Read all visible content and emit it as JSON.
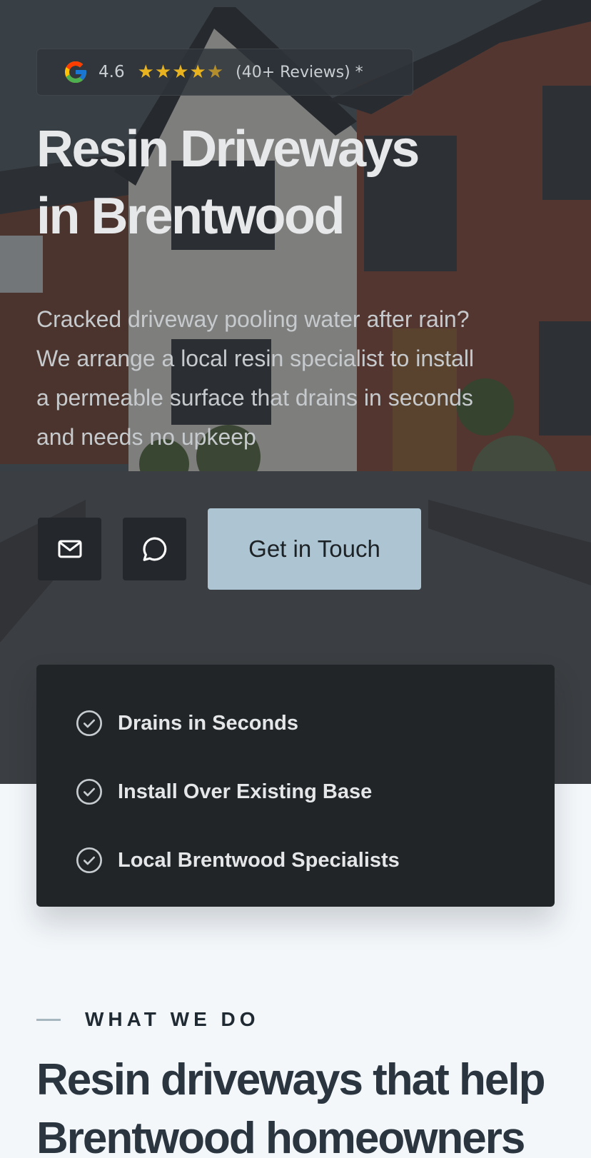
{
  "rating": {
    "icon": "google-icon",
    "score": "4.6",
    "stars": "★★★★",
    "star_partial": "★",
    "count": "(40+ Reviews) *"
  },
  "hero": {
    "title_line1": "Resin Driveways",
    "title_line2": "in Brentwood",
    "subtitle": "Cracked driveway pooling water after rain? We arrange a local resin specialist to install a permeable surface that drains in seconds and needs no upkeep",
    "email_icon": "mail-icon",
    "chat_icon": "chat-bubble-icon",
    "cta_label": "Get in Touch",
    "cta_color": "#adc5d2"
  },
  "features": [
    {
      "icon": "check-circle-icon",
      "label": "Drains in Seconds"
    },
    {
      "icon": "check-circle-icon",
      "label": "Install Over Existing Base"
    },
    {
      "icon": "check-circle-icon",
      "label": "Local Brentwood Specialists"
    }
  ],
  "what_we_do": {
    "eyebrow": "WHAT WE DO",
    "title": "Resin driveways that help Brentwood homeowners"
  }
}
